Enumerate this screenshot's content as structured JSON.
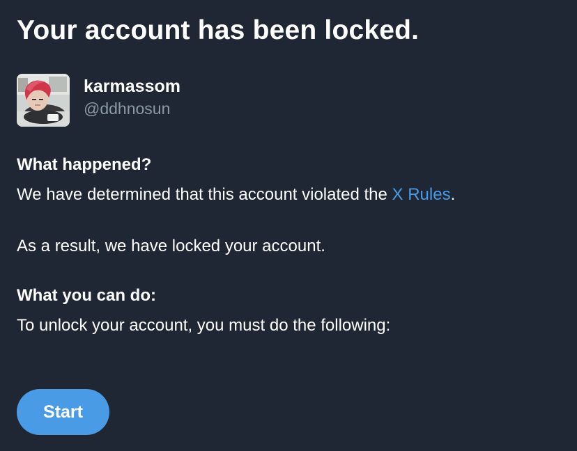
{
  "page": {
    "title": "Your account has been locked."
  },
  "account": {
    "display_name": "karmassom",
    "handle": "@ddhnosun",
    "avatar_icon": "profile-photo"
  },
  "what_happened": {
    "heading": "What happened?",
    "text_before_link": "We have determined that this account violated the ",
    "link_label": "X Rules",
    "text_after_link": ".",
    "result_text": "As a result, we have locked your account."
  },
  "what_you_can_do": {
    "heading": "What you can do:",
    "text": "To unlock your account, you must do the following:"
  },
  "actions": {
    "start_label": "Start"
  },
  "colors": {
    "background": "#1f2735",
    "accent": "#4a9be6",
    "secondary_text": "#8b98a5"
  }
}
